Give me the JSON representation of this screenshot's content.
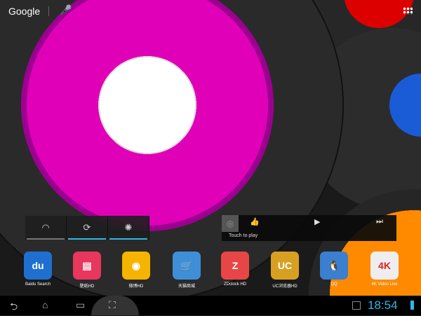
{
  "search": {
    "logo": "Google",
    "mic": "🎤"
  },
  "quick_settings": [
    {
      "name": "wifi",
      "glyph": "◠",
      "on": false
    },
    {
      "name": "sync",
      "glyph": "⟳",
      "on": true
    },
    {
      "name": "brightness",
      "glyph": "✺",
      "on": true
    }
  ],
  "music": {
    "like": "👍",
    "play": "▶",
    "next": "⏭",
    "status": "Touch to play",
    "art": "◎"
  },
  "apps": [
    {
      "label": "Baidu Search",
      "glyph": "du",
      "color": "#1f6fd0"
    },
    {
      "label": "壁纸HD",
      "glyph": "▤",
      "color": "#e8365d"
    },
    {
      "label": "微博HD",
      "glyph": "◉",
      "color": "#f5b400"
    },
    {
      "label": "天猫商城",
      "glyph": "🛒",
      "color": "#3f8fd8"
    },
    {
      "label": "ZDclock HD",
      "glyph": "Z",
      "color": "#e84646"
    },
    {
      "label": "UC浏览器HD",
      "glyph": "UC",
      "color": "#d8a020"
    },
    {
      "label": "QQ",
      "glyph": "🐧",
      "color": "#3a7fd0"
    },
    {
      "label": "4K Video Live",
      "glyph": "4K",
      "color": "#eeeeee"
    }
  ],
  "nav": {
    "back": "⮌",
    "home": "⌂",
    "recent": "▭",
    "screenshot": "⛶"
  },
  "status": {
    "time": "18:54"
  },
  "colors": {
    "accent": "#33b5e5",
    "record": "#e000b8"
  }
}
